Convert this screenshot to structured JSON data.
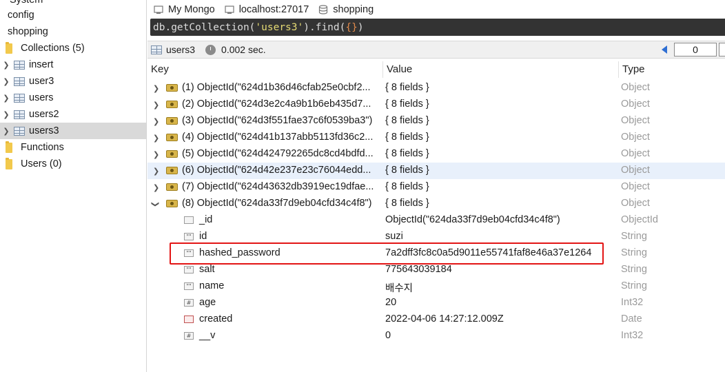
{
  "sidebar": {
    "items": [
      {
        "label": "System",
        "level": 0
      },
      {
        "label": "config",
        "level": 0
      },
      {
        "label": "shopping",
        "level": 0
      },
      {
        "label": "Collections (5)",
        "level": 1,
        "icon": "folder-icon"
      },
      {
        "label": "insert",
        "level": 2,
        "icon": "table-icon"
      },
      {
        "label": "user3",
        "level": 2,
        "icon": "table-icon"
      },
      {
        "label": "users",
        "level": 2,
        "icon": "table-icon"
      },
      {
        "label": "users2",
        "level": 2,
        "icon": "table-icon"
      },
      {
        "label": "users3",
        "level": 2,
        "icon": "table-icon",
        "selected": true
      },
      {
        "label": "Functions",
        "level": 1,
        "icon": "folder-icon"
      },
      {
        "label": "Users (0)",
        "level": 1,
        "icon": "folder-icon"
      }
    ]
  },
  "connection": {
    "server": "My Mongo",
    "host": "localhost:27017",
    "database": "shopping"
  },
  "query": {
    "prefix": "db.getCollection(",
    "collection_literal": "'users3'",
    "middle": ").find(",
    "args": "{}",
    "suffix": ")"
  },
  "result": {
    "collection": "users3",
    "time": "0.002 sec.",
    "page": "0"
  },
  "grid": {
    "headers": {
      "key": "Key",
      "value": "Value",
      "type": "Type"
    },
    "documents": [
      {
        "key": "(1) ObjectId(\"624d1b36d46cfab25e0cbf2...",
        "value": "{ 8 fields }",
        "type": "Object",
        "expanded": false
      },
      {
        "key": "(2) ObjectId(\"624d3e2c4a9b1b6eb435d7...",
        "value": "{ 8 fields }",
        "type": "Object",
        "expanded": false
      },
      {
        "key": "(3) ObjectId(\"624d3f551fae37c6f0539ba3\")",
        "value": "{ 8 fields }",
        "type": "Object",
        "expanded": false
      },
      {
        "key": "(4) ObjectId(\"624d41b137abb5113fd36c2...",
        "value": "{ 8 fields }",
        "type": "Object",
        "expanded": false
      },
      {
        "key": "(5) ObjectId(\"624d424792265dc8cd4bdfd...",
        "value": "{ 8 fields }",
        "type": "Object",
        "expanded": false
      },
      {
        "key": "(6) ObjectId(\"624d42e237e23c76044edd...",
        "value": "{ 8 fields }",
        "type": "Object",
        "expanded": false,
        "highlighted": true
      },
      {
        "key": "(7) ObjectId(\"624d43632db3919ec19dfae...",
        "value": "{ 8 fields }",
        "type": "Object",
        "expanded": false
      },
      {
        "key": "(8) ObjectId(\"624da33f7d9eb04cfd34c4f8\")",
        "value": "{ 8 fields }",
        "type": "Object",
        "expanded": true
      }
    ],
    "fields": [
      {
        "key": "_id",
        "value": "ObjectId(\"624da33f7d9eb04cfd34c4f8\")",
        "type": "ObjectId",
        "icon": "objectid-icon",
        "glyph": ""
      },
      {
        "key": "id",
        "value": "suzi",
        "type": "String",
        "icon": "string-icon",
        "glyph": "\"\""
      },
      {
        "key": "hashed_password",
        "value": "7a2dff3fc8c0a5d9011e55741faf8e46a37e1264",
        "type": "String",
        "icon": "string-icon",
        "glyph": "\"\""
      },
      {
        "key": "salt",
        "value": "775643039184",
        "type": "String",
        "icon": "string-icon",
        "glyph": "\"\""
      },
      {
        "key": "name",
        "value": "배수지",
        "type": "String",
        "icon": "string-icon",
        "glyph": "\"\""
      },
      {
        "key": "age",
        "value": "20",
        "type": "Int32",
        "icon": "number-icon",
        "glyph": "#"
      },
      {
        "key": "created",
        "value": "2022-04-06 14:27:12.009Z",
        "type": "Date",
        "icon": "date-icon",
        "glyph": ""
      },
      {
        "key": "__v",
        "value": "0",
        "type": "Int32",
        "icon": "number-icon",
        "glyph": "#"
      }
    ]
  },
  "colors": {
    "query_bg": "#333333",
    "highlight_border": "#e31414",
    "selected_row": "#d9d9d9",
    "hover_row": "#e8f0fb"
  }
}
